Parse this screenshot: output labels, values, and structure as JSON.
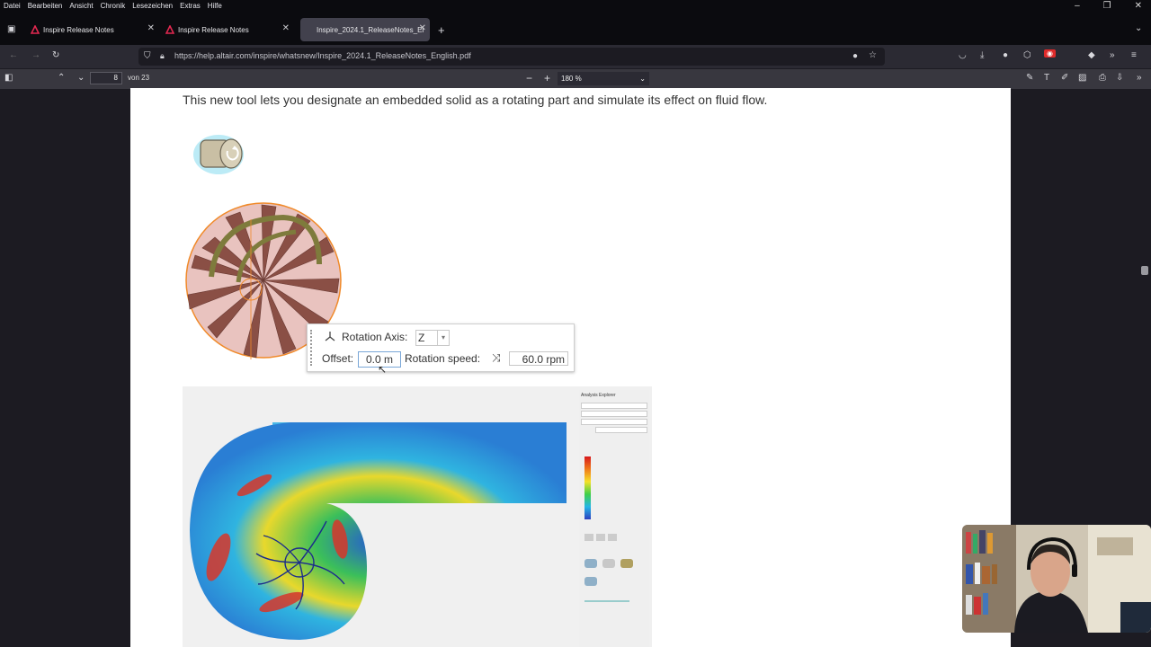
{
  "menubar": {
    "items": [
      "Datei",
      "Bearbeiten",
      "Ansicht",
      "Chronik",
      "Lesezeichen",
      "Extras",
      "Hilfe"
    ]
  },
  "tabs": [
    {
      "label": "Inspire Release Notes",
      "active": false
    },
    {
      "label": "Inspire Release Notes",
      "active": false
    },
    {
      "label": "Inspire_2024.1_ReleaseNotes_Er",
      "active": true
    }
  ],
  "nav": {
    "url": "https://help.altair.com/inspire/whatsnew/Inspire_2024.1_ReleaseNotes_English.pdf"
  },
  "pdf_toolbar": {
    "page_number": "8",
    "page_count": "von 23",
    "zoom": "180 %"
  },
  "document": {
    "intro_text": "This new tool lets you designate an embedded solid as a rotating part and simulate its effect on fluid flow.",
    "rotation_panel": {
      "axis_label": "Rotation Axis:",
      "axis_value": "Z",
      "offset_label": "Offset:",
      "offset_value": "0.0 m",
      "speed_label": "Rotation speed:",
      "speed_value": "60.0 rpm"
    },
    "explorer_title": "Analysis Explorer"
  },
  "colors": {
    "accent_red": "#e22850",
    "tab_active": "#42414d",
    "toolbar": "#2b2a33",
    "legend_top": "#d7191c",
    "legend_bottom": "#2c3fbf"
  }
}
